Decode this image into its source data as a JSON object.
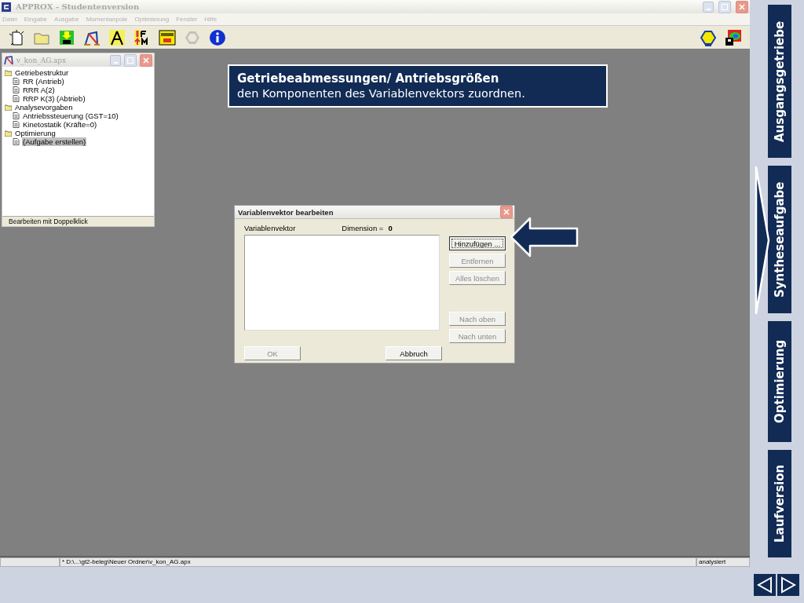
{
  "window": {
    "title": "APPROX - Studentenversion"
  },
  "menu": [
    "Datei",
    "Eingabe",
    "Ausgabe",
    "Momentanpole",
    "Optimierung",
    "Fenster",
    "Hilfe"
  ],
  "document_window": {
    "title": "v_kon_AG.apx",
    "tree": [
      {
        "label": "Getriebestruktur",
        "kind": "folder",
        "selected": false,
        "children": [
          {
            "label": "RR (Antrieb)",
            "kind": "document",
            "selected": false
          },
          {
            "label": "RRR A(2)",
            "kind": "document",
            "selected": false
          },
          {
            "label": "RRP K(3) (Abtrieb)",
            "kind": "document",
            "selected": false
          }
        ]
      },
      {
        "label": "Analysevorgaben",
        "kind": "folder",
        "selected": false,
        "children": [
          {
            "label": "Antriebssteuerung (GST=10)",
            "kind": "document",
            "selected": false
          },
          {
            "label": "Kinetostatik (Kräfte=0)",
            "kind": "document",
            "selected": false
          }
        ]
      },
      {
        "label": "Optimierung",
        "kind": "folder",
        "selected": false,
        "children": [
          {
            "label": "(Aufgabe erstellen)",
            "kind": "document",
            "selected": true
          }
        ]
      }
    ],
    "status": "Bearbeiten mit Doppelklick"
  },
  "callout": {
    "title": "Getriebeabmessungen/ Antriebsgrößen",
    "text": "den Komponenten des Variablenvektors zuordnen."
  },
  "dialog": {
    "title": "Variablenvektor bearbeiten",
    "list_label": "Variablenvektor",
    "dimension_label": "Dimension =",
    "dimension_value": "0",
    "side_buttons": [
      {
        "label": "Hinzufügen ...",
        "disabled": false,
        "focused": true
      },
      {
        "label": "Entfernen",
        "disabled": true,
        "focused": false
      },
      {
        "label": "Alles löschen",
        "disabled": true,
        "focused": false
      },
      {
        "label": "Nach oben",
        "disabled": true,
        "focused": false
      },
      {
        "label": "Nach unten",
        "disabled": true,
        "focused": false
      }
    ],
    "bottom_buttons": [
      {
        "label": "OK",
        "disabled": true,
        "focused": false
      },
      {
        "label": "Abbruch",
        "disabled": false,
        "focused": false
      }
    ]
  },
  "status_bar": {
    "path": "* D:\\...\\gt2-beleg\\Neuer Ordner\\v_kon_AG.apx",
    "state": "analysiert"
  },
  "nav_tabs": [
    {
      "label": "Ausgangsgetriebe",
      "selected": false
    },
    {
      "label": "Syntheseaufgabe",
      "selected": true
    },
    {
      "label": "Optimierung",
      "selected": false
    },
    {
      "label": "Laufversion",
      "selected": false
    }
  ]
}
